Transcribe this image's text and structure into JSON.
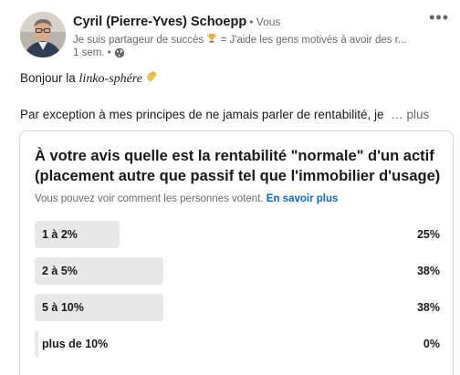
{
  "author": {
    "name": "Cyril (Pierre-Yves) Schoepp",
    "degree": "• Vous",
    "headline_before": "Je suis partageur de succès",
    "headline_after": " = J'aide les gens motivés à avoir des r...",
    "time": "1 sem. •"
  },
  "icons": {
    "more": "more-horizontal-icon",
    "globe": "globe-icon",
    "trophy": "trophy-icon",
    "wave": "waving-hand-icon"
  },
  "post": {
    "greeting_prefix": "Bonjour la ",
    "greeting_italic": "linko-sphére",
    "line2": "Par exception à mes principes de ne jamais parler de rentabilité, je",
    "see_more": "… plus"
  },
  "poll": {
    "question": "À votre avis quelle est la rentabilité \"normale\" d'un actif (placement autre que passif tel que l'immobilier d'usage)",
    "voters_text": "Vous pouvez voir comment les personnes votent.",
    "learn_more": "En savoir plus",
    "options": [
      {
        "label": "1 à 2%",
        "percent_text": "25%",
        "share": 0.25
      },
      {
        "label": "2 à 5%",
        "percent_text": "38%",
        "share": 0.38
      },
      {
        "label": "5 à 10%",
        "percent_text": "38%",
        "share": 0.38
      },
      {
        "label": "plus de 10%",
        "percent_text": "0%",
        "share": 0
      }
    ]
  },
  "colors": {
    "link": "#0a66c2",
    "bar": "#e8e8e8",
    "border": "#d9d9d9"
  }
}
